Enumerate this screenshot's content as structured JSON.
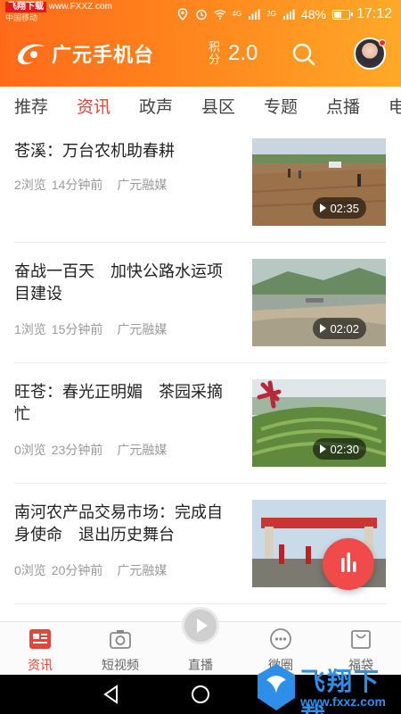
{
  "status_bar": {
    "watermark_badge": "飞翔下载",
    "watermark_url": "www.FXXZ.com",
    "carrier": "中国移动",
    "battery": "48%",
    "time": "17:12",
    "signal_small_1": "4G",
    "signal_small_2": "2G",
    "battery_level": 0.48
  },
  "header": {
    "app_name": "广元手机台",
    "points_label_1": "积",
    "points_label_2": "分",
    "points_value": "2.0"
  },
  "tabs": [
    {
      "label": "推荐",
      "active": false
    },
    {
      "label": "资讯",
      "active": true
    },
    {
      "label": "政声",
      "active": false
    },
    {
      "label": "县区",
      "active": false
    },
    {
      "label": "专题",
      "active": false
    },
    {
      "label": "点播",
      "active": false
    },
    {
      "label": "电",
      "active": false
    }
  ],
  "feed": [
    {
      "title": "苍溪：万台农机助春耕",
      "views": "2浏览",
      "time": "14分钟前",
      "source": "广元融媒",
      "duration": "02:35"
    },
    {
      "title": "奋战一百天　加快公路水运项目建设",
      "views": "1浏览",
      "time": "15分钟前",
      "source": "广元融媒",
      "duration": "02:02"
    },
    {
      "title": "旺苍：春光正明媚　茶园采摘忙",
      "views": "0浏览",
      "time": "23分钟前",
      "source": "广元融媒",
      "duration": "02:30"
    },
    {
      "title": "南河农产品交易市场：完成自身使命　退出历史舞台",
      "views": "0浏览",
      "time": "20分钟前",
      "source": "广元融媒",
      "duration": ""
    }
  ],
  "bottom_nav": [
    {
      "label": "资讯",
      "icon": "news-icon",
      "active": true
    },
    {
      "label": "短视频",
      "icon": "camera-icon",
      "active": false
    },
    {
      "label": "直播",
      "icon": "play-icon",
      "active": false
    },
    {
      "label": "微圈",
      "icon": "chat-icon",
      "active": false
    },
    {
      "label": "福袋",
      "icon": "bag-icon",
      "active": false
    }
  ],
  "watermark": {
    "brand": "飞翔下载",
    "url": "www.fxxz.com"
  },
  "colors": {
    "accent": "#e2453a",
    "header_start": "#ff6a1a",
    "header_end": "#ffa928",
    "fab": "#f04a4a"
  }
}
